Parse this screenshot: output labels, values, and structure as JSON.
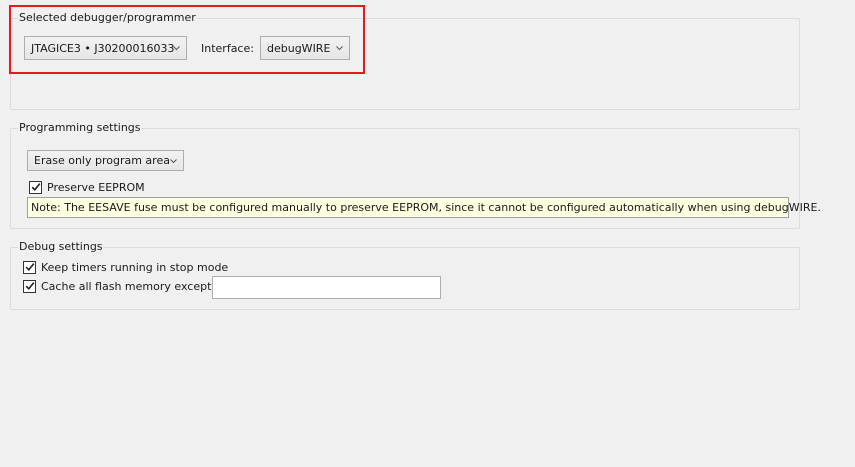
{
  "debugger_group": {
    "title": "Selected debugger/programmer",
    "tool_select": "JTAGICE3 • J30200016033",
    "interface_label": "Interface:",
    "interface_select": "debugWIRE"
  },
  "programming_group": {
    "title": "Programming settings",
    "erase_select": "Erase only program area",
    "preserve_eeprom": {
      "label": "Preserve EEPROM",
      "checked": true
    },
    "note": "Note: The EESAVE fuse must be configured manually to preserve EEPROM, since it cannot be configured automatically when using debugWIRE."
  },
  "debug_group": {
    "title": "Debug settings",
    "keep_timers": {
      "label": "Keep timers running in stop mode",
      "checked": true
    },
    "cache_flash": {
      "label": "Cache all flash memory except",
      "checked": true,
      "value": ""
    }
  },
  "colors": {
    "highlight": "#e41b1b",
    "note_background": "#ffffe1"
  }
}
